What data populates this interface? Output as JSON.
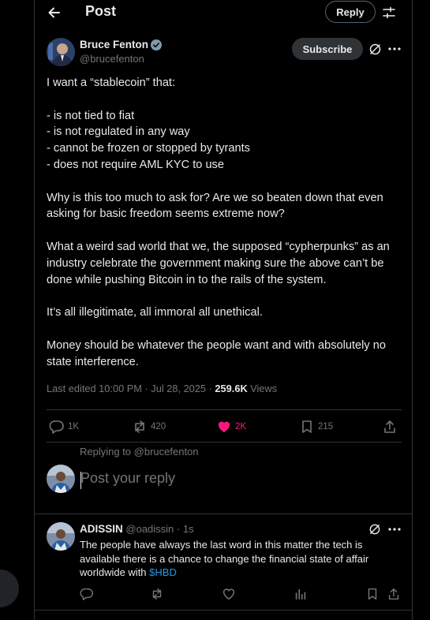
{
  "header": {
    "title": "Post",
    "reply_label": "Reply"
  },
  "post": {
    "author_name": "Bruce Fenton",
    "author_handle": "@brucefenton",
    "subscribe_label": "Subscribe",
    "text": "I want a “stablecoin” that:\n\n- is not tied to fiat\n- is not regulated in any way\n- cannot be frozen or stopped by tyrants\n- does not require AML KYC to use\n\nWhy is this too much to ask for?  Are we so beaten down that even asking for basic freedom seems extreme now?\n\nWhat a weird sad world that we, the supposed “cypherpunks” as an industry celebrate the government making sure the above can’t be done while pushing Bitcoin in to the rails of the system.\n\nIt’s all illegitimate, all immoral all unethical.\n\nMoney should be whatever the people want and with absolutely no state interference.",
    "edited_label": "Last edited 10:00 PM · Jul 28, 2025 · ",
    "views_count": "259.6K",
    "views_label": "Views",
    "actions": {
      "replies": "1K",
      "reposts": "420",
      "likes": "2K",
      "bookmarks": "215"
    },
    "like_color": "#f91880"
  },
  "reply_box": {
    "replying_prefix": "Replying to ",
    "replying_handle": "@brucefenton",
    "placeholder": "Post your reply"
  },
  "comment": {
    "author_name": "ADISSIN",
    "author_handle": "@oadissin",
    "time": "· 1s",
    "text": "The people have always the last word in this matter the tech is available there is a chance to change the financial state of affair worldwide with ",
    "cashtag": "$HBD"
  },
  "colors": {
    "accent": "#1d9bf0",
    "verified": "#829aab"
  }
}
